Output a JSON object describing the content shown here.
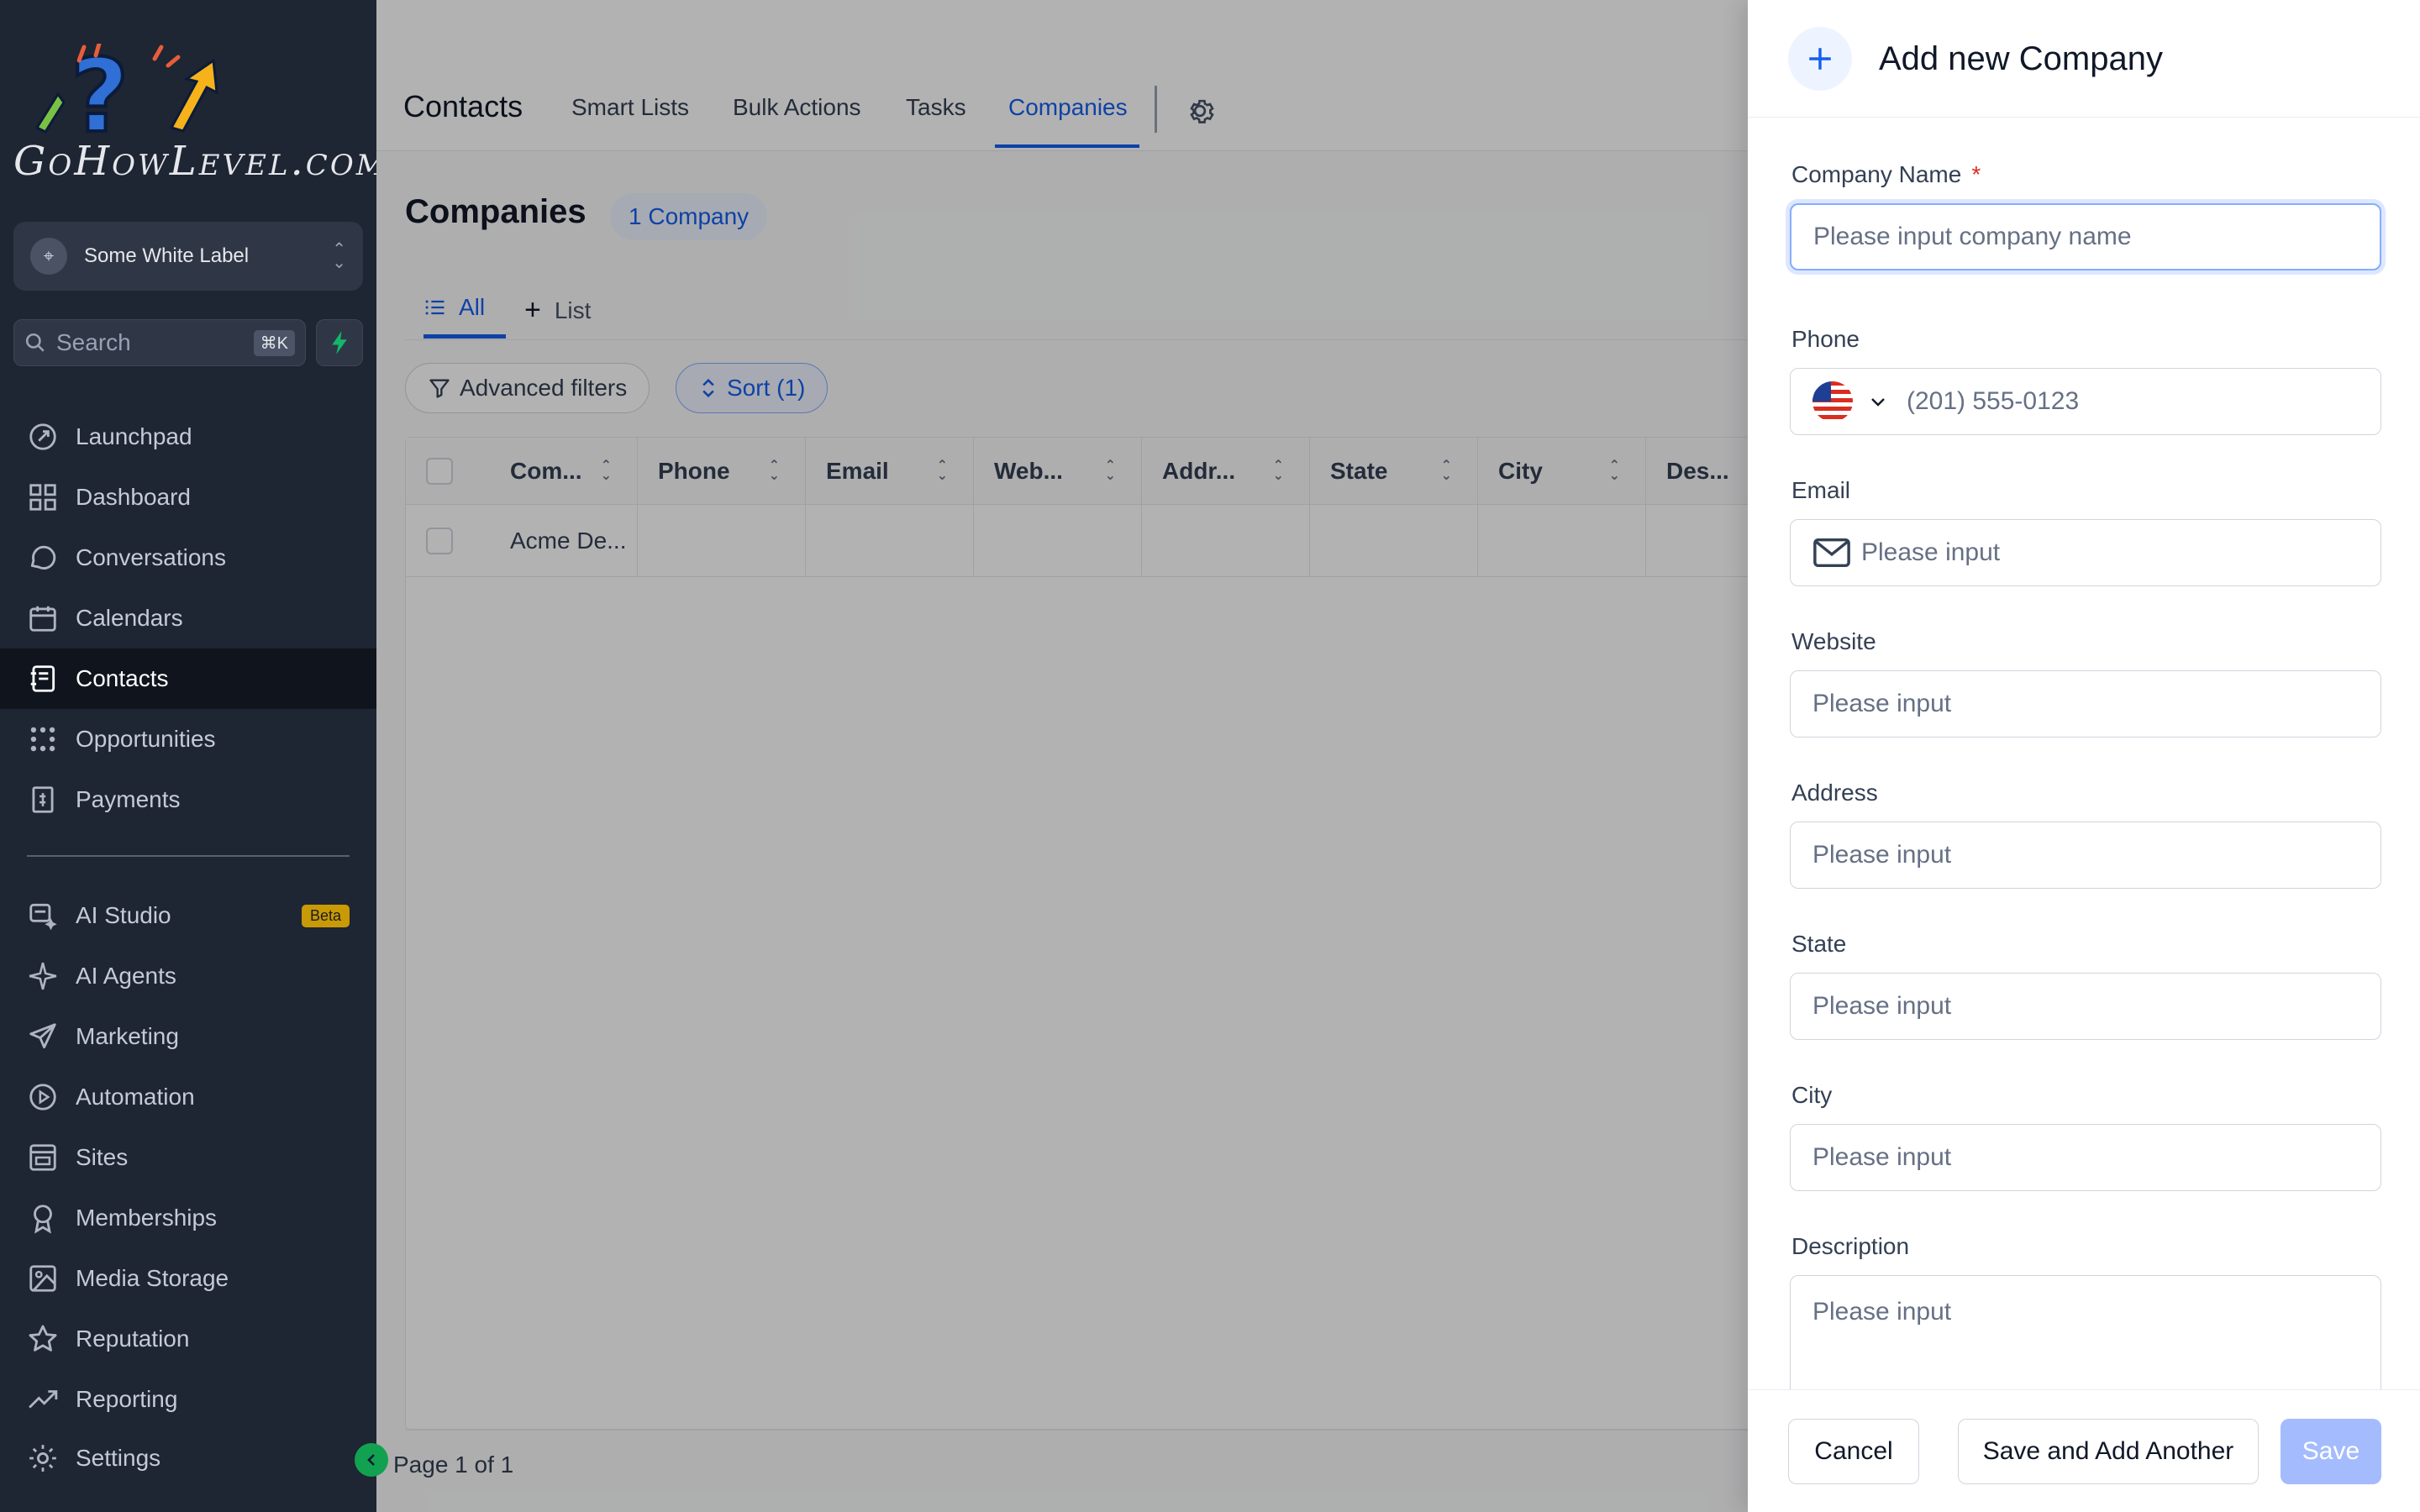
{
  "brand": {
    "logo_text": "GoHowLevel.com"
  },
  "account": {
    "name": "Some White Label"
  },
  "search": {
    "placeholder": "Search",
    "shortcut": "⌘K"
  },
  "sidebar": {
    "items": [
      {
        "label": "Launchpad",
        "icon": "rocket-icon"
      },
      {
        "label": "Dashboard",
        "icon": "dashboard-icon"
      },
      {
        "label": "Conversations",
        "icon": "chat-icon"
      },
      {
        "label": "Calendars",
        "icon": "calendar-icon"
      },
      {
        "label": "Contacts",
        "icon": "contacts-icon",
        "active": true
      },
      {
        "label": "Opportunities",
        "icon": "opportunities-icon"
      },
      {
        "label": "Payments",
        "icon": "payments-icon"
      },
      {
        "label": "AI Studio",
        "icon": "ai-studio-icon",
        "badge": "Beta"
      },
      {
        "label": "AI Agents",
        "icon": "sparkle-icon"
      },
      {
        "label": "Marketing",
        "icon": "send-icon"
      },
      {
        "label": "Automation",
        "icon": "automation-icon"
      },
      {
        "label": "Sites",
        "icon": "sites-icon"
      },
      {
        "label": "Memberships",
        "icon": "award-icon"
      },
      {
        "label": "Media Storage",
        "icon": "image-icon"
      },
      {
        "label": "Reputation",
        "icon": "star-icon"
      },
      {
        "label": "Reporting",
        "icon": "trend-icon"
      },
      {
        "label": "Settings",
        "icon": "gear-icon"
      }
    ]
  },
  "topnav": {
    "title": "Contacts",
    "tabs": [
      "Smart Lists",
      "Bulk Actions",
      "Tasks",
      "Companies"
    ],
    "active_tab": "Companies"
  },
  "page": {
    "heading": "Companies",
    "count_badge": "1 Company",
    "view_tabs": [
      "All",
      "List"
    ],
    "filters_label": "Advanced filters",
    "sort_label": "Sort (1)"
  },
  "table": {
    "columns": [
      "Com...",
      "Phone",
      "Email",
      "Web...",
      "Addr...",
      "State",
      "City",
      "Des..."
    ],
    "rows": [
      [
        "Acme De...",
        "",
        "",
        "",
        "",
        "",
        "",
        ""
      ]
    ],
    "pager": "Page 1 of 1"
  },
  "drawer": {
    "title": "Add new Company",
    "fields": {
      "company_name": {
        "label": "Company Name",
        "required": "*",
        "placeholder": "Please input company name"
      },
      "phone": {
        "label": "Phone",
        "placeholder": "(201) 555-0123"
      },
      "email": {
        "label": "Email",
        "placeholder": "Please input"
      },
      "website": {
        "label": "Website",
        "placeholder": "Please input"
      },
      "address": {
        "label": "Address",
        "placeholder": "Please input"
      },
      "state": {
        "label": "State",
        "placeholder": "Please input"
      },
      "city": {
        "label": "City",
        "placeholder": "Please input"
      },
      "description": {
        "label": "Description",
        "placeholder": "Please input"
      }
    },
    "buttons": {
      "cancel": "Cancel",
      "save_another": "Save and Add Another",
      "save": "Save"
    }
  },
  "colors": {
    "accent": "#155eef",
    "sidebar_bg": "#1e2533",
    "beta_badge": "#c99a06",
    "collapse": "#12a150"
  }
}
